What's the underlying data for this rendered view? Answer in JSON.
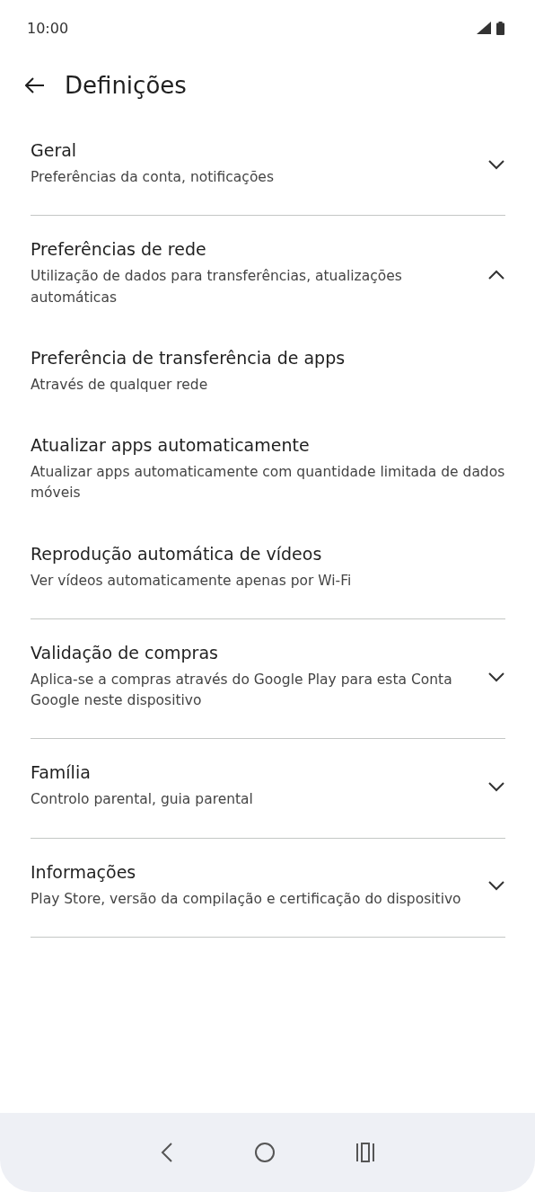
{
  "status_bar": {
    "time": "10:00"
  },
  "header": {
    "title": "Definições"
  },
  "sections": [
    {
      "title": "Geral",
      "subtitle": "Preferências da conta, notificações",
      "expanded": false
    },
    {
      "title": "Preferências de rede",
      "subtitle": "Utilização de dados para transferências, atualizações automáticas",
      "expanded": true,
      "items": [
        {
          "title": "Preferência de transferência de apps",
          "subtitle": "Através de qualquer rede"
        },
        {
          "title": "Atualizar apps automaticamente",
          "subtitle": "Atualizar apps automaticamente com quantidade limitada de dados móveis"
        },
        {
          "title": "Reprodução automática de vídeos",
          "subtitle": "Ver vídeos automaticamente apenas por Wi-Fi"
        }
      ]
    },
    {
      "title": "Validação de compras",
      "subtitle": "Aplica-se a compras através do Google Play para esta Conta Google neste dispositivo",
      "expanded": false
    },
    {
      "title": "Família",
      "subtitle": "Controlo parental, guia parental",
      "expanded": false
    },
    {
      "title": "Informações",
      "subtitle": "Play Store, versão da compilação e certificação do dispositivo",
      "expanded": false
    }
  ]
}
